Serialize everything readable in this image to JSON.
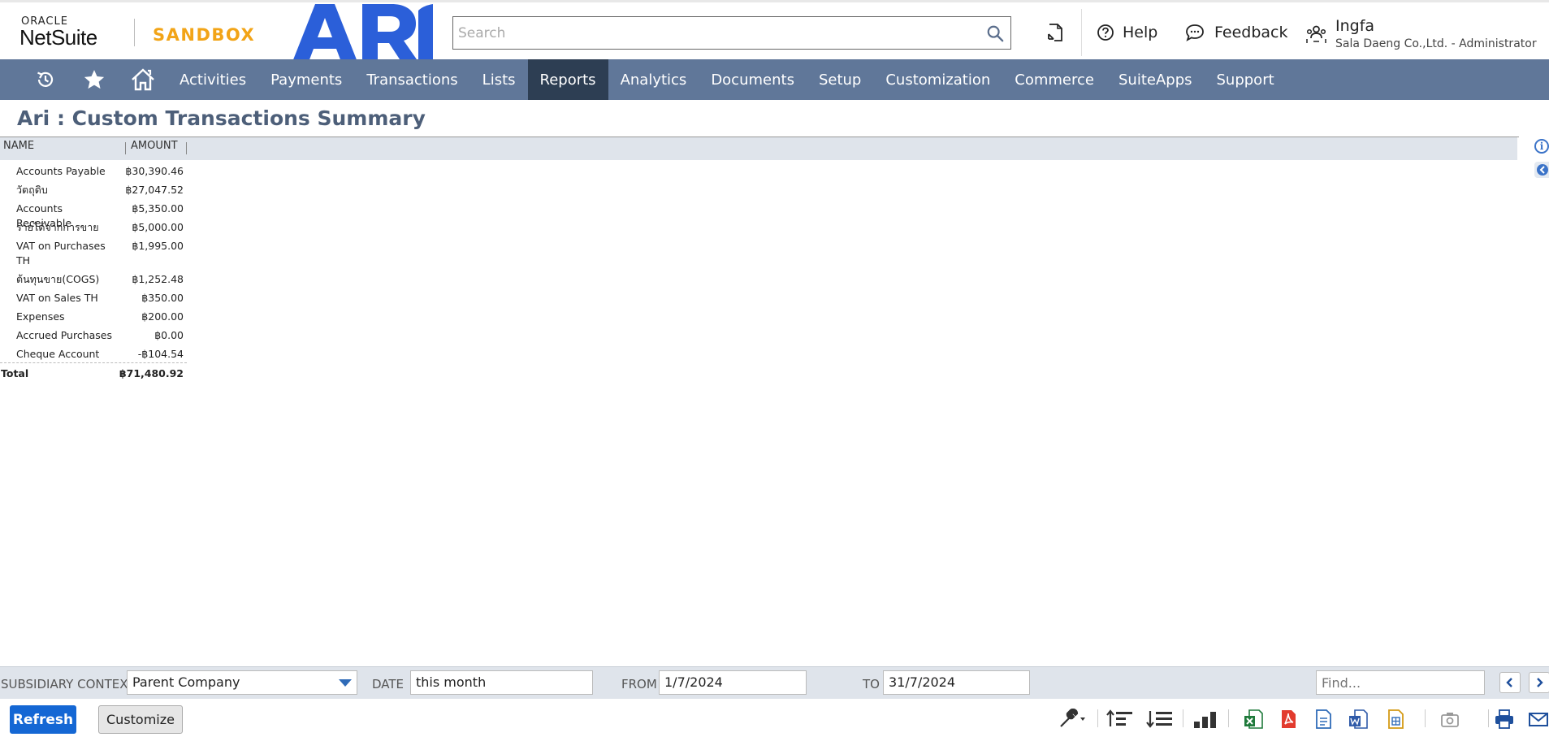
{
  "header": {
    "brand_small": "ORACLE",
    "brand_main": "NetSuite",
    "environment": "SANDBOX",
    "search_placeholder": "Search",
    "help_label": "Help",
    "feedback_label": "Feedback",
    "user_name": "Ingfa",
    "user_role": "Sala Daeng Co.,Ltd. - Administrator",
    "colors": {
      "sandbox": "#f2a417",
      "ari_logo": "#2b5fd9"
    }
  },
  "nav": {
    "icons": [
      "recent-records-icon",
      "favorites-star-icon",
      "home-icon"
    ],
    "items": [
      "Activities",
      "Payments",
      "Transactions",
      "Lists",
      "Reports",
      "Analytics",
      "Documents",
      "Setup",
      "Customization",
      "Commerce",
      "SuiteApps",
      "Support"
    ],
    "active": "Reports",
    "colors": {
      "bar": "#607799",
      "active": "#2d3e53"
    }
  },
  "page": {
    "title": "Ari : Custom Transactions Summary"
  },
  "table": {
    "headers": {
      "name": "NAME",
      "amount": "AMOUNT"
    },
    "rows": [
      {
        "name": "Accounts Payable",
        "amount": "฿30,390.46"
      },
      {
        "name": "วัตถุดิบ",
        "amount": "฿27,047.52"
      },
      {
        "name": "Accounts Receivable",
        "amount": "฿5,350.00"
      },
      {
        "name": "รายได้จากการขาย",
        "amount": "฿5,000.00"
      },
      {
        "name": "VAT on Purchases TH",
        "amount": "฿1,995.00"
      },
      {
        "name": "ต้นทุนขาย(COGS)",
        "amount": "฿1,252.48"
      },
      {
        "name": "VAT on Sales TH",
        "amount": "฿350.00"
      },
      {
        "name": "Expenses",
        "amount": "฿200.00"
      },
      {
        "name": "Accrued Purchases",
        "amount": "฿0.00"
      },
      {
        "name": "Cheque Account",
        "amount": "-฿104.54"
      }
    ],
    "total": {
      "name": "Total",
      "amount": "฿71,480.92"
    }
  },
  "filters": {
    "subsidiary_label": "SUBSIDIARY CONTEXT",
    "subsidiary_value": "Parent Company",
    "date_label": "DATE",
    "date_value": "this month",
    "from_label": "FROM",
    "from_value": "1/7/2024",
    "to_label": "TO",
    "to_value": "31/7/2024",
    "find_placeholder": "Find..."
  },
  "actions": {
    "refresh_label": "Refresh",
    "customize_label": "Customize",
    "tools": [
      "wrench-icon",
      "collapse-all-icon",
      "expand-all-icon",
      "chart-icon",
      "excel-export-icon",
      "pdf-export-icon",
      "csv-export-icon",
      "word-export-icon",
      "xml-export-icon",
      "snapshot-icon",
      "print-icon",
      "email-icon"
    ]
  }
}
